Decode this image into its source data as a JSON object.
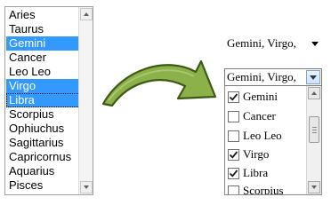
{
  "listbox": {
    "items": [
      {
        "label": "Aries",
        "selected": false
      },
      {
        "label": "Taurus",
        "selected": false
      },
      {
        "label": "Gemini",
        "selected": true
      },
      {
        "label": "Cancer",
        "selected": false
      },
      {
        "label": "Leo Leo",
        "selected": false
      },
      {
        "label": "Virgo",
        "selected": true
      },
      {
        "label": "Libra",
        "selected": true
      },
      {
        "label": "Scorpius",
        "selected": false
      },
      {
        "label": "Ophiuchus",
        "selected": false
      },
      {
        "label": "Sagittarius",
        "selected": false
      },
      {
        "label": "Capricornus",
        "selected": false
      },
      {
        "label": "Aquarius",
        "selected": false
      },
      {
        "label": "Pisces",
        "selected": false
      }
    ],
    "selection_color": "#3399ff"
  },
  "arrow": {
    "icon": "curved-arrow-icon",
    "color": "#8cb04a"
  },
  "collapsed_select": {
    "value": "Gemini, Virgo,"
  },
  "expanded_select": {
    "value": "Gemini, Virgo,",
    "options": [
      {
        "label": "Gemini",
        "checked": true
      },
      {
        "label": "Cancer",
        "checked": false
      },
      {
        "label": "Leo Leo",
        "checked": false
      },
      {
        "label": "Virgo",
        "checked": true
      },
      {
        "label": "Libra",
        "checked": true
      },
      {
        "label": "Scorpius",
        "checked": false
      }
    ]
  }
}
